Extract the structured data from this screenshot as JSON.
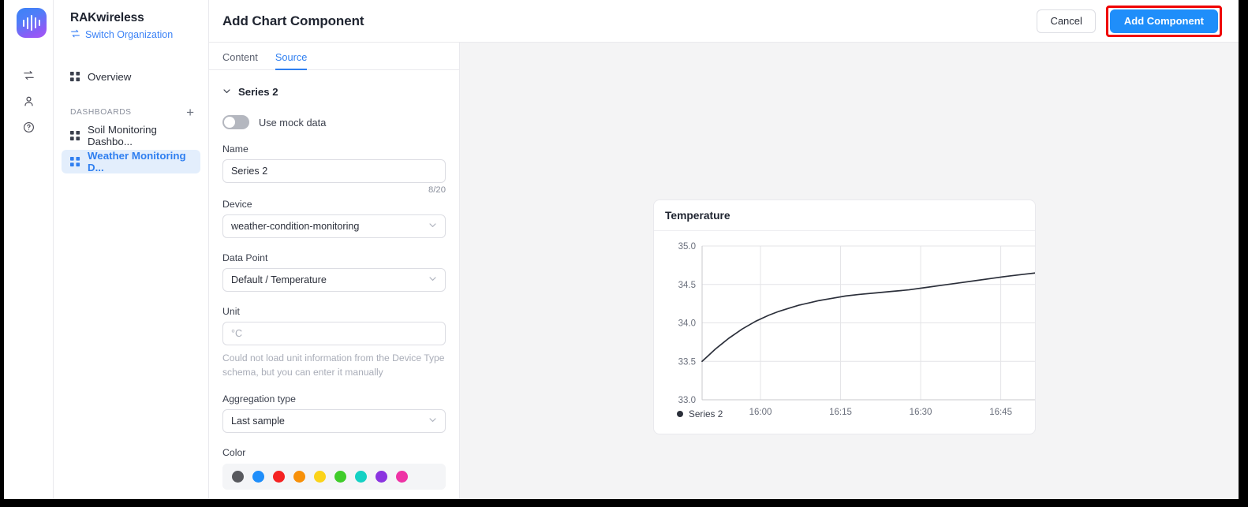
{
  "app": {
    "rail_icons": [
      "switch-icon",
      "user-icon",
      "help-icon"
    ],
    "logo_name": "rakwireless-logo"
  },
  "sidebar": {
    "org_name": "RAKwireless",
    "switch_org_label": "Switch Organization",
    "overview_label": "Overview",
    "section_label": "DASHBOARDS",
    "add_dashboard_label": "+",
    "dashboards": [
      {
        "label": "Soil Monitoring Dashbo...",
        "active": false
      },
      {
        "label": "Weather Monitoring D...",
        "active": true
      }
    ]
  },
  "topbar": {
    "title": "Add Chart Component",
    "cancel_label": "Cancel",
    "add_component_label": "Add Component",
    "highlight_color": "#ef0000",
    "primary_color": "#1f8efa"
  },
  "form": {
    "tabs": [
      {
        "label": "Content",
        "active": false
      },
      {
        "label": "Source",
        "active": true
      }
    ],
    "series_section_title": "Series 2",
    "mock_data_label": "Use mock data",
    "mock_data_on": false,
    "name_label": "Name",
    "name_value": "Series 2",
    "name_counter": "8/20",
    "device_label": "Device",
    "device_value": "weather-condition-monitoring",
    "data_point_label": "Data Point",
    "data_point_value": "Default / Temperature",
    "unit_label": "Unit",
    "unit_placeholder": "°C",
    "unit_value": "",
    "unit_helper": "Could not load unit information from the Device Type schema, but you can enter it manually",
    "aggregation_label": "Aggregation type",
    "aggregation_value": "Last sample",
    "color_label": "Color",
    "colors": [
      "#58595e",
      "#1f8efa",
      "#f52222",
      "#f79009",
      "#fbd319",
      "#3fcc2a",
      "#14d1c4",
      "#8b34e0",
      "#ee33a5"
    ]
  },
  "chart_data": {
    "type": "line",
    "title": "Temperature",
    "xlabel": "",
    "ylabel": "",
    "ylim": [
      33.0,
      35.0
    ],
    "yticks": [
      33.0,
      33.5,
      34.0,
      34.5,
      35.0
    ],
    "ytick_labels": [
      "33.0",
      "33.5",
      "34.0",
      "34.5",
      "35.0"
    ],
    "xticks": [
      "16:00",
      "16:15",
      "16:30",
      "16:45"
    ],
    "xtick_fracs": [
      0.175,
      0.415,
      0.655,
      0.895
    ],
    "grid": true,
    "legend_position": "bottom-left",
    "series": [
      {
        "name": "Series 2",
        "color": "#2b2f3a",
        "x": [
          0.0,
          0.02,
          0.04,
          0.06,
          0.08,
          0.1,
          0.12,
          0.14,
          0.16,
          0.18,
          0.2,
          0.23,
          0.26,
          0.29,
          0.32,
          0.35,
          0.39,
          0.43,
          0.47,
          0.52,
          0.57,
          0.62,
          0.67,
          0.72,
          0.77,
          0.82,
          0.87,
          0.92,
          0.96,
          1.0
        ],
        "y": [
          33.5,
          33.58,
          33.66,
          33.73,
          33.8,
          33.86,
          33.92,
          33.97,
          34.02,
          34.06,
          34.1,
          34.15,
          34.19,
          34.23,
          34.26,
          34.29,
          34.32,
          34.35,
          34.37,
          34.39,
          34.41,
          34.43,
          34.46,
          34.49,
          34.52,
          34.55,
          34.58,
          34.61,
          34.63,
          34.65
        ]
      }
    ]
  }
}
